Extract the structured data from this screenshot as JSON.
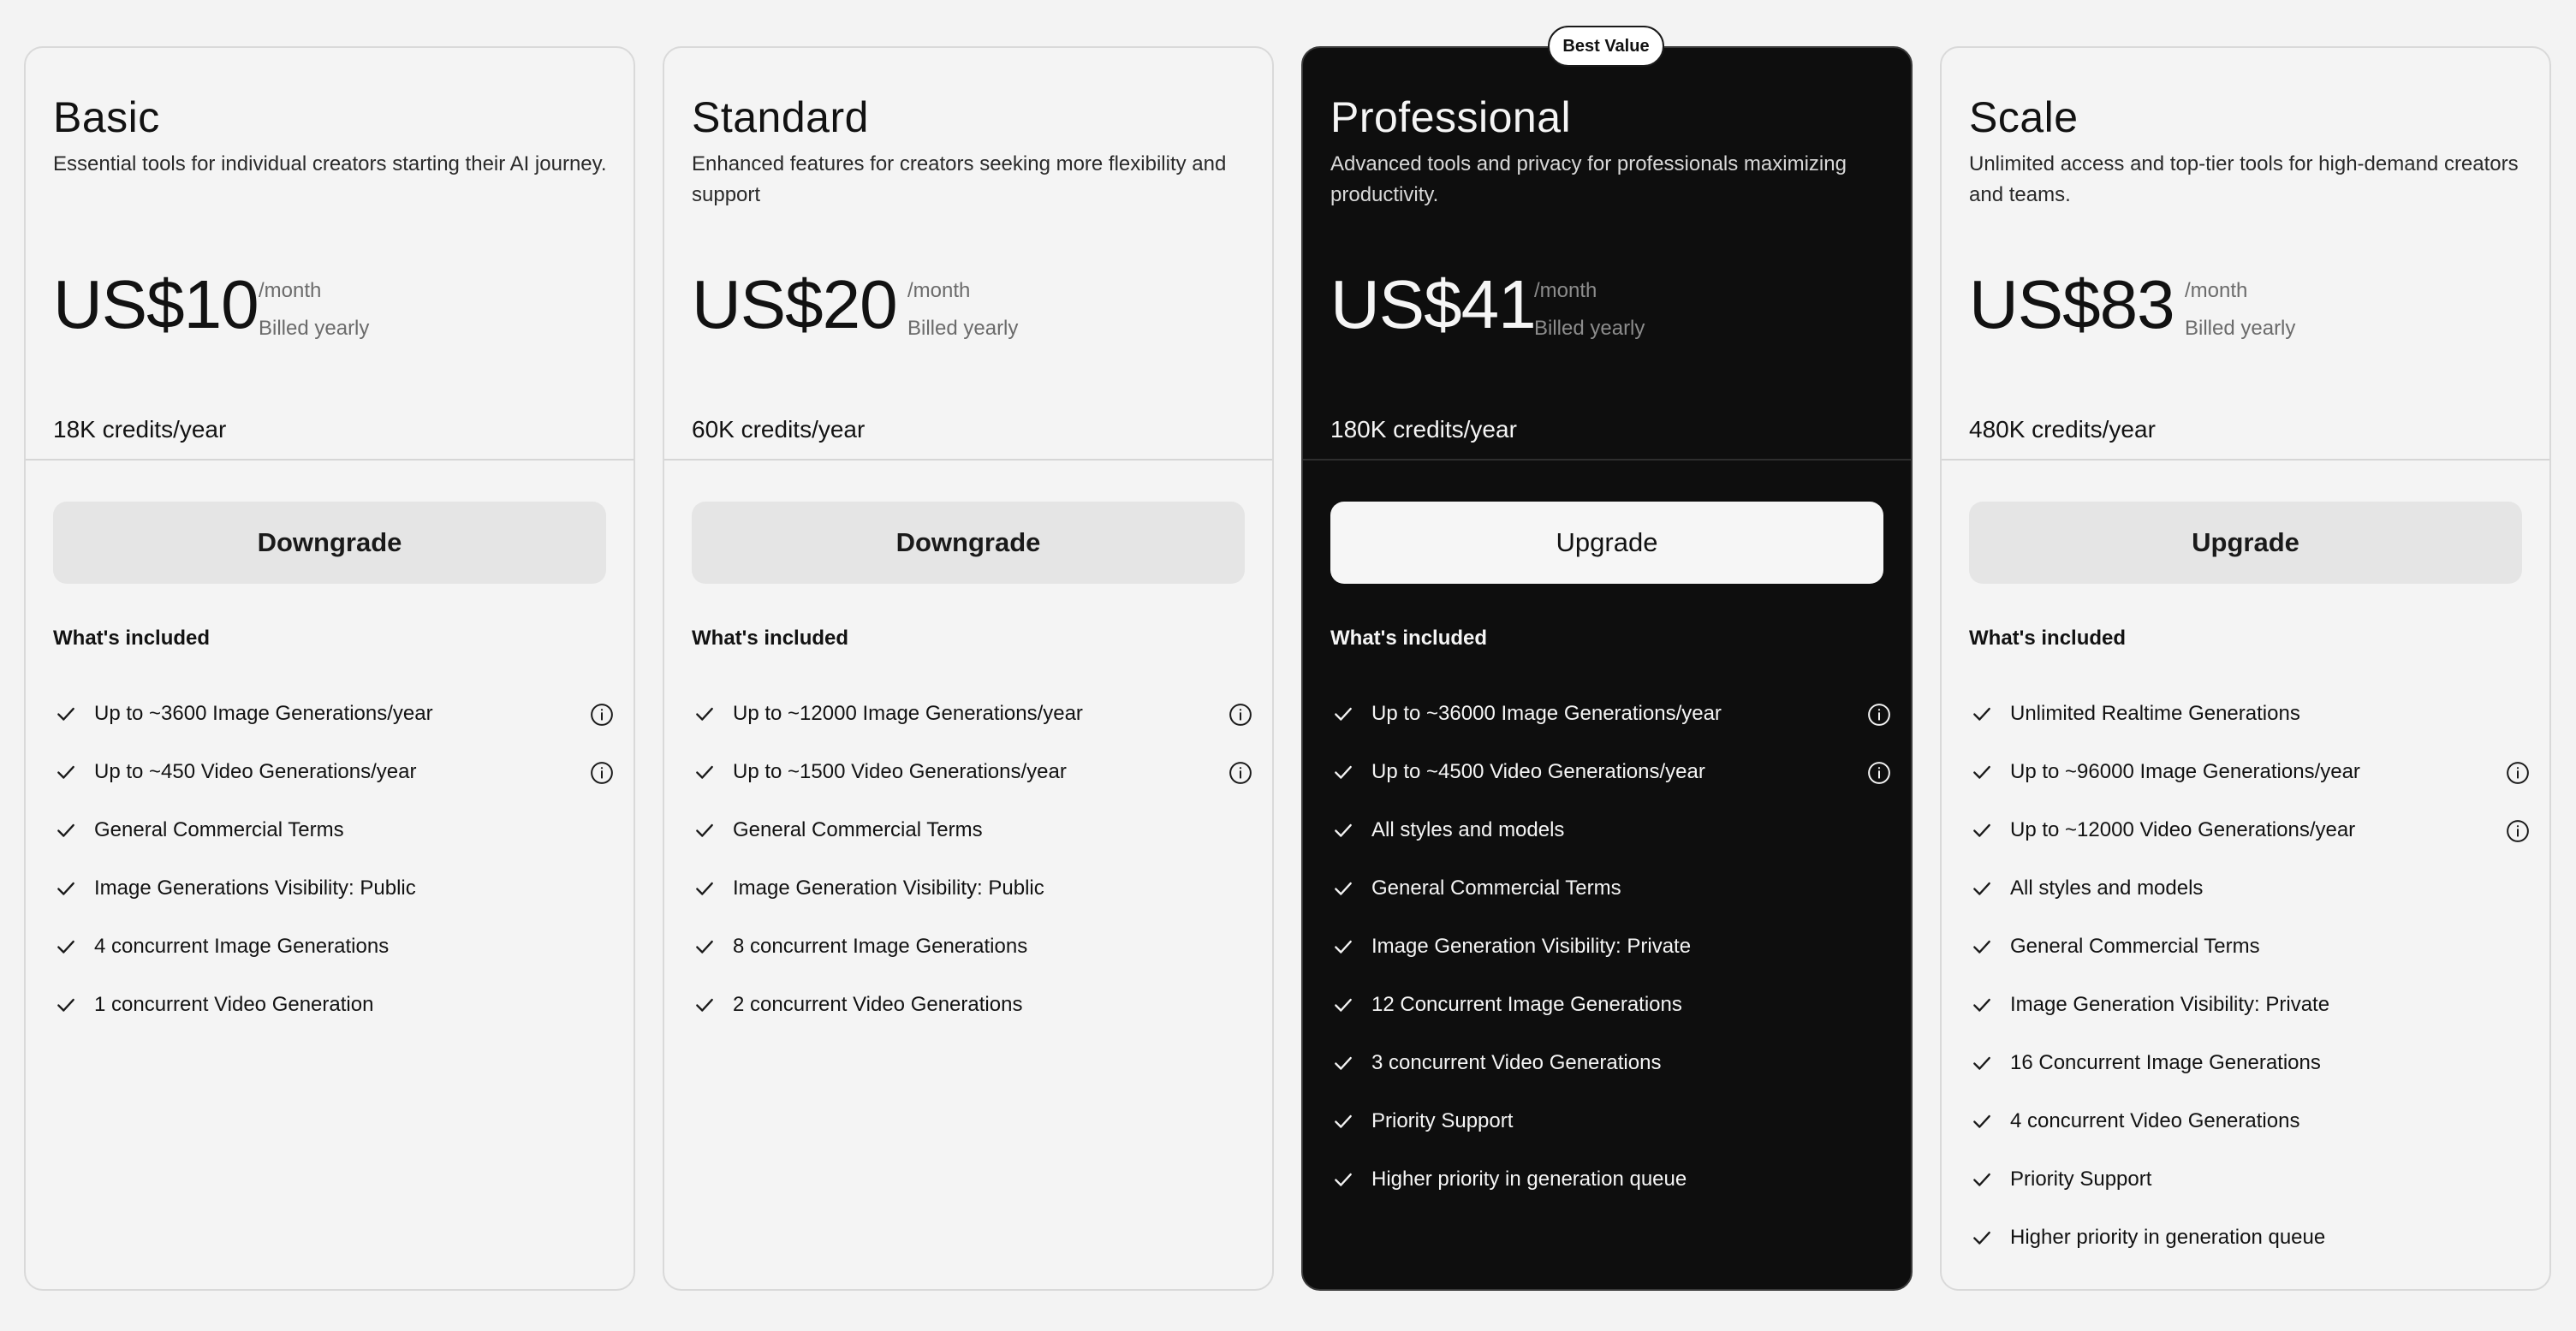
{
  "best_value_badge": "Best Value",
  "plans": [
    {
      "name": "Basic",
      "description": "Essential tools for individual creators starting their AI journey.",
      "price": "US$10",
      "period": "/month",
      "billing": "Billed yearly",
      "credits": "18K credits/year",
      "button": "Downgrade",
      "included_title": "What's included",
      "features": [
        {
          "text": "Up to ~3600 Image Generations/year",
          "info": true
        },
        {
          "text": "Up to ~450 Video Generations/year",
          "info": true
        },
        {
          "text": "General Commercial Terms",
          "info": false
        },
        {
          "text": "Image Generations Visibility: Public",
          "info": false
        },
        {
          "text": "4 concurrent Image Generations",
          "info": false
        },
        {
          "text": "1 concurrent Video Generation",
          "info": false
        }
      ]
    },
    {
      "name": "Standard",
      "description": "Enhanced features for creators seeking more flexibility and support",
      "price": "US$20",
      "period": "/month",
      "billing": "Billed yearly",
      "credits": "60K credits/year",
      "button": "Downgrade",
      "included_title": "What's included",
      "features": [
        {
          "text": "Up to ~12000 Image Generations/year",
          "info": true
        },
        {
          "text": "Up to ~1500 Video Generations/year",
          "info": true
        },
        {
          "text": "General Commercial Terms",
          "info": false
        },
        {
          "text": "Image Generation Visibility: Public",
          "info": false
        },
        {
          "text": "8 concurrent Image Generations",
          "info": false
        },
        {
          "text": "2 concurrent Video Generations",
          "info": false
        }
      ]
    },
    {
      "name": "Professional",
      "description": "Advanced tools and privacy for professionals maximizing productivity.",
      "price": "US$41",
      "period": "/month",
      "billing": "Billed yearly",
      "credits": "180K credits/year",
      "button": "Upgrade",
      "included_title": "What's included",
      "features": [
        {
          "text": "Up to ~36000 Image Generations/year",
          "info": true
        },
        {
          "text": "Up to ~4500 Video Generations/year",
          "info": true
        },
        {
          "text": "All styles and models",
          "info": false
        },
        {
          "text": "General Commercial Terms",
          "info": false
        },
        {
          "text": "Image Generation Visibility: Private",
          "info": false
        },
        {
          "text": "12 Concurrent Image Generations",
          "info": false
        },
        {
          "text": "3 concurrent Video Generations",
          "info": false
        },
        {
          "text": "Priority Support",
          "info": false
        },
        {
          "text": "Higher priority in generation queue",
          "info": false
        }
      ]
    },
    {
      "name": "Scale",
      "description": "Unlimited access and top-tier tools for high-demand creators and teams.",
      "price": "US$83",
      "period": "/month",
      "billing": "Billed yearly",
      "credits": "480K credits/year",
      "button": "Upgrade",
      "included_title": "What's included",
      "features": [
        {
          "text": "Unlimited Realtime Generations",
          "info": false
        },
        {
          "text": "Up to ~96000 Image Generations/year",
          "info": true
        },
        {
          "text": "Up to ~12000 Video Generations/year",
          "info": true
        },
        {
          "text": "All styles and models",
          "info": false
        },
        {
          "text": "General Commercial Terms",
          "info": false
        },
        {
          "text": "Image Generation Visibility: Private",
          "info": false
        },
        {
          "text": "16 Concurrent Image Generations",
          "info": false
        },
        {
          "text": "4 concurrent Video Generations",
          "info": false
        },
        {
          "text": "Priority Support",
          "info": false
        },
        {
          "text": "Higher priority in generation queue",
          "info": false
        }
      ]
    }
  ],
  "icons": {
    "check": "check-icon",
    "info": "info-icon"
  },
  "colors": {
    "page": "#f3f3f3",
    "card": "#f4f4f4",
    "featured_card": "#0e0e0e",
    "button": "#e5e5e5",
    "featured_button": "#f6f6f6"
  }
}
